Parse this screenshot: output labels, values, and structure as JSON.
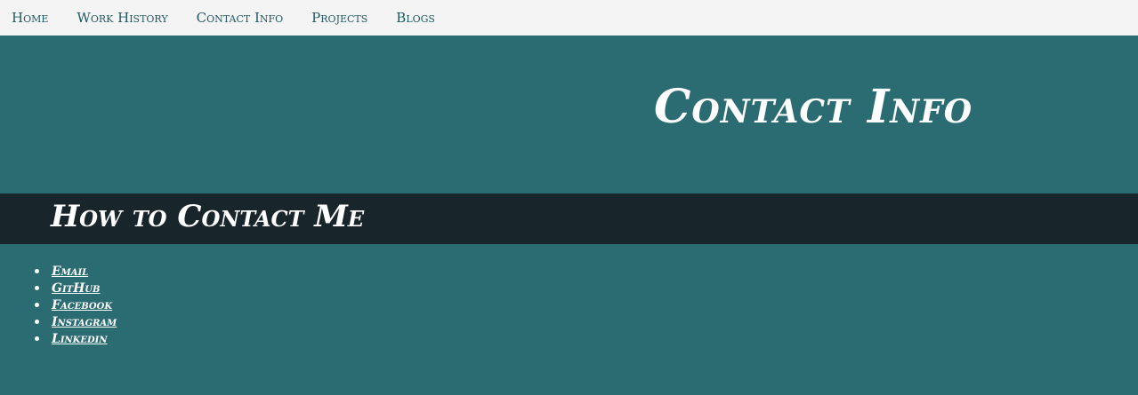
{
  "nav": {
    "items": [
      {
        "label": "Home"
      },
      {
        "label": "Work History"
      },
      {
        "label": "Contact Info"
      },
      {
        "label": "Projects"
      },
      {
        "label": "Blogs"
      }
    ]
  },
  "hero": {
    "title": "Contact Info"
  },
  "section": {
    "title": "How to Contact Me"
  },
  "contacts": {
    "items": [
      {
        "label": "Email"
      },
      {
        "label": "GitHub"
      },
      {
        "label": "Facebook"
      },
      {
        "label": "Instagram"
      },
      {
        "label": "Linkedin"
      }
    ]
  },
  "colors": {
    "nav_bg": "#f4f4f4",
    "nav_text": "#1e5a64",
    "page_bg": "#2b6c73",
    "section_bar_bg": "#18262c",
    "text_light": "#ffffff"
  }
}
